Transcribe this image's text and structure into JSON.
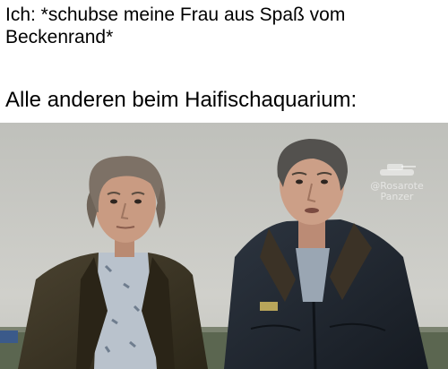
{
  "meme": {
    "caption_top": "Ich: *schubse meine Frau aus Spaß vom Beckenrand*",
    "caption_bottom": "Alle anderen beim Haifischaquarium:"
  },
  "watermark": {
    "line1": "@Rosarote",
    "line2": "Panzer",
    "icon": "tank-icon"
  },
  "photo": {
    "description_icon": "two-men-photo",
    "colors": {
      "sky": "#c9c9c4",
      "ground": "#5b6650",
      "jacket_left": "#3a3424",
      "jacket_right": "#232a33",
      "skin": "#c99b82"
    }
  }
}
